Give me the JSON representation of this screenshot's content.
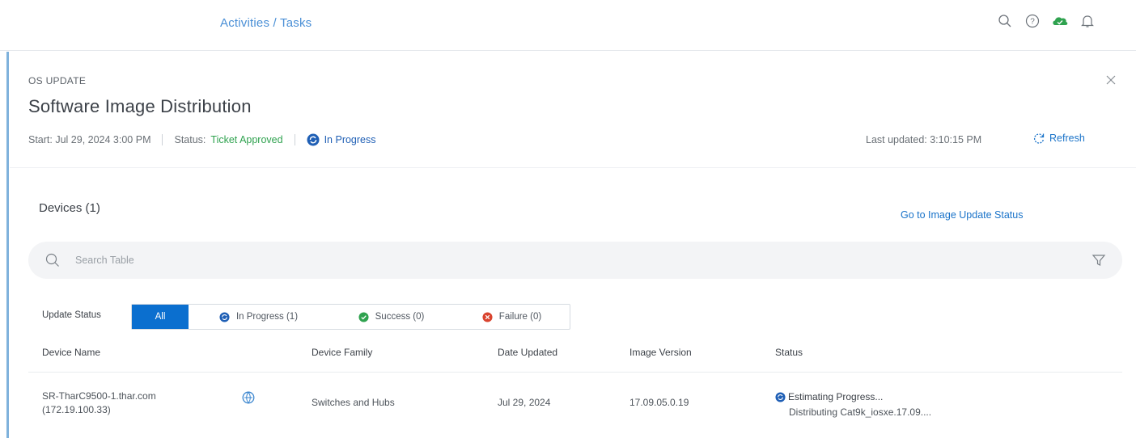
{
  "header": {
    "breadcrumb": "Activities / Tasks"
  },
  "panel": {
    "category": "OS UPDATE",
    "title": "Software Image Distribution",
    "start": "Start: Jul 29, 2024 3:00 PM",
    "status_label": "Status:",
    "status_value": "Ticket Approved",
    "progress_label": "In Progress",
    "last_updated": "Last updated: 3:10:15 PM",
    "refresh_label": "Refresh"
  },
  "devices": {
    "title": "Devices (1)",
    "go_link": "Go to Image Update Status",
    "search_placeholder": "Search Table",
    "update_status_label": "Update Status",
    "filters": [
      {
        "label": "All",
        "icon": "none",
        "active": true
      },
      {
        "label": "In Progress (1)",
        "icon": "in-progress-icon",
        "active": false
      },
      {
        "label": "Success (0)",
        "icon": "success-icon",
        "active": false
      },
      {
        "label": "Failure (0)",
        "icon": "failure-icon",
        "active": false
      }
    ],
    "columns": [
      "Device Name",
      "Device Family",
      "Date Updated",
      "Image Version",
      "Status"
    ],
    "rows": [
      {
        "name": "SR-TharC9500-1.thar.com",
        "ip": "(172.19.100.33)",
        "family": "Switches and Hubs",
        "date": "Jul 29, 2024",
        "version": "17.09.05.0.19",
        "status": "Estimating Progress...",
        "status_detail": "Distributing Cat9k_iosxe.17.09...."
      }
    ]
  },
  "colors": {
    "accent_blue": "#0b6fcf",
    "link_blue": "#1a73c9",
    "success_green": "#2fa24f",
    "failure_red": "#d9432e",
    "progress_blue": "#1f5fb5"
  }
}
